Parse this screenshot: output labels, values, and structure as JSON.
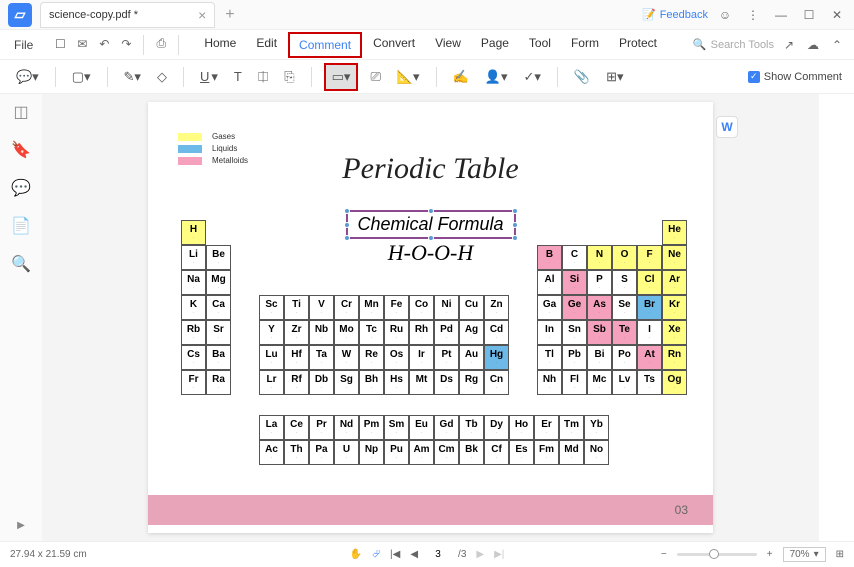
{
  "tab": {
    "title": "science-copy.pdf *"
  },
  "feedback": "Feedback",
  "menu": {
    "file": "File",
    "items": [
      "Home",
      "Edit",
      "Comment",
      "Convert",
      "View",
      "Page",
      "Tool",
      "Form",
      "Protect"
    ],
    "active_index": 2,
    "search_placeholder": "Search Tools"
  },
  "toolbar": {
    "show_comment": "Show Comment"
  },
  "legend": {
    "gases": "Gases",
    "liquids": "Liquids",
    "metalloids": "Metalloids",
    "colors": {
      "gases": "#fffd82",
      "liquids": "#6db9e8",
      "metalloids": "#f5a1bd"
    }
  },
  "doc": {
    "title": "Periodic Table",
    "annotation": "Chemical Formula",
    "formula": "H-O-O-H",
    "page_label": "03"
  },
  "status": {
    "dims": "27.94 x 21.59 cm",
    "page_current": "3",
    "page_total": "/3",
    "zoom": "70%"
  },
  "chart_data": {
    "type": "table",
    "title": "Periodic Table",
    "legend": [
      {
        "name": "Gases",
        "color": "#fffd82"
      },
      {
        "name": "Liquids",
        "color": "#6db9e8"
      },
      {
        "name": "Metalloids",
        "color": "#f5a1bd"
      }
    ],
    "left_block": [
      [
        "H",
        ""
      ],
      [
        "Li",
        "Be"
      ],
      [
        "Na",
        "Mg"
      ],
      [
        "K",
        "Ca"
      ],
      [
        "Rb",
        "Sr"
      ],
      [
        "Cs",
        "Ba"
      ],
      [
        "Fr",
        "Ra"
      ]
    ],
    "right_block": [
      [
        "",
        "",
        "",
        "",
        "",
        "He"
      ],
      [
        "B",
        "C",
        "N",
        "O",
        "F",
        "Ne"
      ],
      [
        "Al",
        "Si",
        "P",
        "S",
        "Cl",
        "Ar"
      ],
      [
        "Ga",
        "Ge",
        "As",
        "Se",
        "Br",
        "Kr"
      ],
      [
        "In",
        "Sn",
        "Sb",
        "Te",
        "I",
        "Xe"
      ],
      [
        "Tl",
        "Pb",
        "Bi",
        "Po",
        "At",
        "Rn"
      ],
      [
        "Nh",
        "Fl",
        "Mc",
        "Lv",
        "Ts",
        "Og"
      ]
    ],
    "transition_block": [
      [
        "Sc",
        "Ti",
        "V",
        "Cr",
        "Mn",
        "Fe",
        "Co",
        "Ni",
        "Cu",
        "Zn"
      ],
      [
        "Y",
        "Zr",
        "Nb",
        "Mo",
        "Tc",
        "Ru",
        "Rh",
        "Pd",
        "Ag",
        "Cd"
      ],
      [
        "Lu",
        "Hf",
        "Ta",
        "W",
        "Re",
        "Os",
        "Ir",
        "Pt",
        "Au",
        "Hg"
      ],
      [
        "Lr",
        "Rf",
        "Db",
        "Sg",
        "Bh",
        "Hs",
        "Mt",
        "Ds",
        "Rg",
        "Cn"
      ]
    ],
    "lanthanides_actinides": [
      [
        "La",
        "Ce",
        "Pr",
        "Nd",
        "Pm",
        "Sm",
        "Eu",
        "Gd",
        "Tb",
        "Dy",
        "Ho",
        "Er",
        "Tm",
        "Yb"
      ],
      [
        "Ac",
        "Th",
        "Pa",
        "U",
        "Np",
        "Pu",
        "Am",
        "Cm",
        "Bk",
        "Cf",
        "Es",
        "Fm",
        "Md",
        "No"
      ]
    ],
    "cell_classes": {
      "H": "gas",
      "He": "gas",
      "Ne": "gas",
      "Ar": "gas",
      "Kr": "gas",
      "Xe": "gas",
      "Rn": "gas",
      "Og": "gas",
      "N": "gas",
      "O": "gas",
      "F": "gas",
      "Cl": "gas",
      "B": "metalloid",
      "Si": "metalloid",
      "Ge": "metalloid",
      "As": "metalloid",
      "Sb": "metalloid",
      "Te": "metalloid",
      "At": "metalloid",
      "Br": "liquid",
      "Hg": "liquid"
    }
  }
}
